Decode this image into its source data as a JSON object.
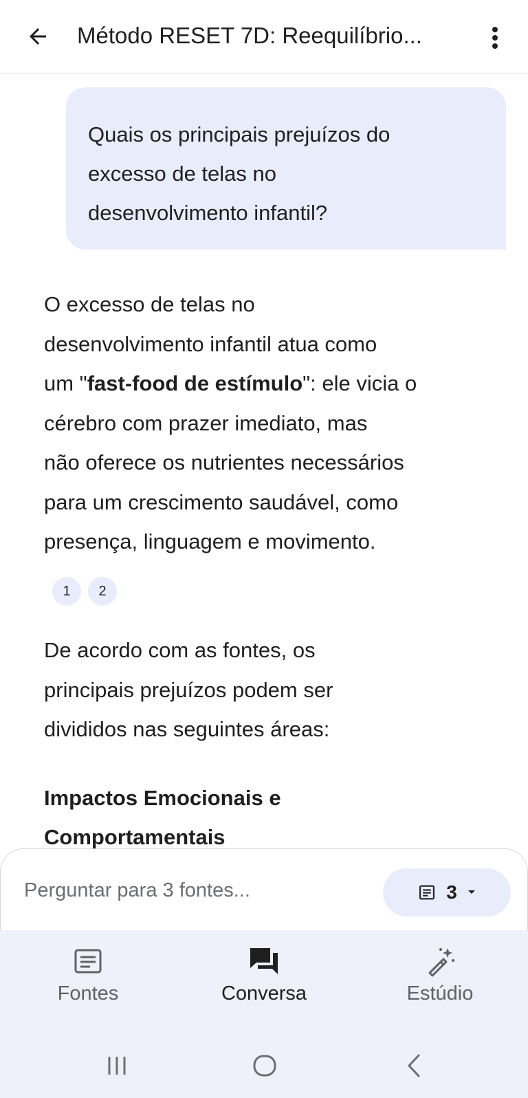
{
  "header": {
    "back_icon": "arrow-left-icon",
    "title": "Método RESET 7D: Reequilíbrio...",
    "menu_icon": "more-vert-icon"
  },
  "chat": {
    "user_question_lines": [
      "Quais os principais prejuízos do",
      "excesso de telas no",
      "desenvolvimento infantil?"
    ],
    "answer": {
      "line1": "O excesso de telas no",
      "line2": "desenvolvimento infantil atua como",
      "line3_pre": "um \"",
      "line3_bold": "fast-food de estímulo",
      "line3_post": "\": ele vicia o",
      "line4": "cérebro com prazer imediato, mas",
      "line5": "não oferece os nutrientes necessários",
      "line6": "para um crescimento saudável, como",
      "line7": "presença, linguagem e movimento."
    },
    "citations": [
      "1",
      "2"
    ],
    "paragraph2_lines": [
      "De acordo com as fontes, os",
      "principais prejuízos podem ser",
      "divididos nas seguintes áreas:"
    ],
    "section_heading_lines": [
      "Impactos Emocionais e",
      "Comportamentais"
    ]
  },
  "composer": {
    "placeholder": "Perguntar para 3 fontes...",
    "source_count": "3",
    "source_icon": "document-icon",
    "dropdown_icon": "caret-down-icon"
  },
  "bottom_nav": {
    "items": [
      {
        "label": "Fontes",
        "icon": "sources-icon",
        "active": false
      },
      {
        "label": "Conversa",
        "icon": "chat-icon",
        "active": true
      },
      {
        "label": "Estúdio",
        "icon": "magic-wand-icon",
        "active": false
      }
    ]
  },
  "system_nav": [
    "recents-icon",
    "home-icon",
    "back-icon"
  ],
  "colors": {
    "bubble": "#e9ecfb",
    "nav_background": "#eef0fa",
    "text": "#1f1f1f",
    "muted": "#5f6368"
  }
}
